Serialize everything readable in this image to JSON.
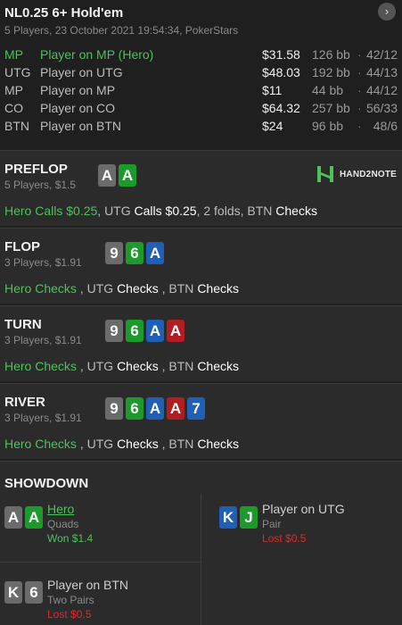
{
  "header": {
    "title": "NL0.25 6+ Hold'em",
    "subtitle": "5 Players, 23 October 2021 19:54:34, PokerStars",
    "next_icon": "chevron-right-icon"
  },
  "players": [
    {
      "pos": "MP",
      "name": "Player on MP (Hero)",
      "stack": "$31.58",
      "bb": "126 bb",
      "sep": "·",
      "hud": "42/12",
      "hero": true
    },
    {
      "pos": "UTG",
      "name": "Player on UTG",
      "stack": "$48.03",
      "bb": "192 bb",
      "sep": "·",
      "hud": "44/13",
      "hero": false
    },
    {
      "pos": "MP",
      "name": "Player on MP",
      "stack": "$11",
      "bb": "44 bb",
      "sep": "·",
      "hud": "44/12",
      "hero": false
    },
    {
      "pos": "CO",
      "name": "Player on CO",
      "stack": "$64.32",
      "bb": "257 bb",
      "sep": "·",
      "hud": "56/33",
      "hero": false
    },
    {
      "pos": "BTN",
      "name": "Player on BTN",
      "stack": "$24",
      "bb": "96 bb",
      "sep": "·",
      "hud": "48/6",
      "hero": false
    }
  ],
  "logo": {
    "text": "HAND2NOTE",
    "color": "#4ec15a"
  },
  "streets": {
    "preflop": {
      "name": "PREFLOP",
      "meta": "5 Players, $1.5",
      "cards": [
        {
          "rank": "A",
          "suit": "s"
        },
        {
          "rank": "A",
          "suit": "c"
        }
      ],
      "actions": {
        "hero": "Hero",
        "hero_act": " Calls $0.25",
        "p1": ", UTG ",
        "p1_act": "Calls $0.25",
        "p2": ", 2 folds, BTN ",
        "p2_act": "Checks"
      }
    },
    "flop": {
      "name": "FLOP",
      "meta": "3 Players, $1.91",
      "cards": [
        {
          "rank": "9",
          "suit": "s"
        },
        {
          "rank": "6",
          "suit": "c"
        },
        {
          "rank": "A",
          "suit": "d"
        }
      ],
      "actions": {
        "hero": "Hero",
        "hero_act": " Checks",
        "p1": " , UTG ",
        "p1_act": "Checks",
        "p2": " , BTN ",
        "p2_act": "Checks"
      }
    },
    "turn": {
      "name": "TURN",
      "meta": "3 Players, $1.91",
      "cards": [
        {
          "rank": "9",
          "suit": "s"
        },
        {
          "rank": "6",
          "suit": "c"
        },
        {
          "rank": "A",
          "suit": "d"
        },
        {
          "rank": "A",
          "suit": "h"
        }
      ],
      "actions": {
        "hero": "Hero",
        "hero_act": " Checks",
        "p1": " , UTG ",
        "p1_act": "Checks",
        "p2": " , BTN ",
        "p2_act": "Checks"
      }
    },
    "river": {
      "name": "RIVER",
      "meta": "3 Players, $1.91",
      "cards": [
        {
          "rank": "9",
          "suit": "s"
        },
        {
          "rank": "6",
          "suit": "c"
        },
        {
          "rank": "A",
          "suit": "d"
        },
        {
          "rank": "A",
          "suit": "h"
        },
        {
          "rank": "7",
          "suit": "d"
        }
      ],
      "actions": {
        "hero": "Hero",
        "hero_act": " Checks",
        "p1": " , UTG ",
        "p1_act": "Checks",
        "p2": " , BTN ",
        "p2_act": "Checks"
      }
    }
  },
  "showdown": {
    "title": "SHOWDOWN",
    "players": [
      {
        "name": "Hero",
        "rank": "Quads",
        "result": "Won $1.4",
        "outcome": "won",
        "cards": [
          {
            "rank": "A",
            "suit": "s"
          },
          {
            "rank": "A",
            "suit": "c"
          }
        ]
      },
      {
        "name": "Player on UTG",
        "rank": "Pair",
        "result": "Lost $0.5",
        "outcome": "lost",
        "cards": [
          {
            "rank": "K",
            "suit": "d"
          },
          {
            "rank": "J",
            "suit": "c"
          }
        ]
      },
      {
        "name": "Player on BTN",
        "rank": "Two Pairs",
        "result": "Lost $0.5",
        "outcome": "lost",
        "cards": [
          {
            "rank": "K",
            "suit": "s"
          },
          {
            "rank": "6",
            "suit": "s"
          }
        ]
      }
    ]
  },
  "colors": {
    "spade": "#6b6b6b",
    "club": "#1d9a2c",
    "diamond": "#1f5fb5",
    "heart": "#b01e22",
    "hero": "#4ec15a",
    "lost": "#e02a2a"
  }
}
